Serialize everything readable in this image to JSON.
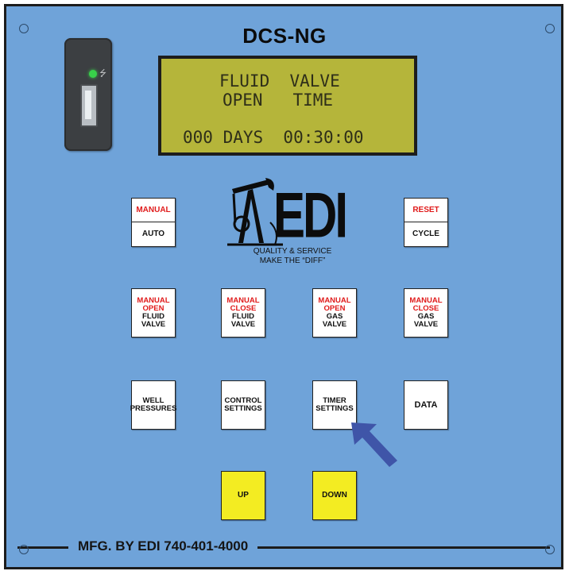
{
  "panel": {
    "title": "DCS-NG",
    "footer": "MFG. BY EDI 740-401-4000"
  },
  "lcd": {
    "line1": "FLUID  VALVE",
    "line2": "OPEN   TIME",
    "line3": "000 DAYS  00:30:00"
  },
  "logo": {
    "text": "EDI",
    "tagline_1": "QUALITY & SERVICE",
    "tagline_2": "MAKE THE “DIFF”"
  },
  "usb": {
    "icon": "usb-icon",
    "led_color": "#38d14a"
  },
  "buttons": {
    "manual_auto": {
      "top": "MANUAL",
      "bottom": "AUTO"
    },
    "reset_cycle": {
      "top": "RESET",
      "bottom": "CYCLE"
    },
    "manual_open_fluid": {
      "l1": "MANUAL",
      "l2": "OPEN",
      "l3": "FLUID",
      "l4": "VALVE"
    },
    "manual_close_fluid": {
      "l1": "MANUAL",
      "l2": "CLOSE",
      "l3": "FLUID",
      "l4": "VALVE"
    },
    "manual_open_gas": {
      "l1": "MANUAL",
      "l2": "OPEN",
      "l3": "GAS",
      "l4": "VALVE"
    },
    "manual_close_gas": {
      "l1": "MANUAL",
      "l2": "CLOSE",
      "l3": "GAS",
      "l4": "VALVE"
    },
    "well_pressures": {
      "l1": "WELL",
      "l2": "PRESSURES"
    },
    "control_settings": {
      "l1": "CONTROL",
      "l2": "SETTINGS"
    },
    "timer_settings": {
      "l1": "TIMER",
      "l2": "SETTINGS"
    },
    "data": {
      "l1": "DATA"
    },
    "up": {
      "l1": "UP"
    },
    "down": {
      "l1": "DOWN"
    }
  },
  "colors": {
    "panel": "#6fa3d9",
    "lcd": "#b5b53a",
    "accent_red": "#e01a1a",
    "yellow_button": "#f3ec22",
    "pointer_arrow": "#3f55a8"
  }
}
